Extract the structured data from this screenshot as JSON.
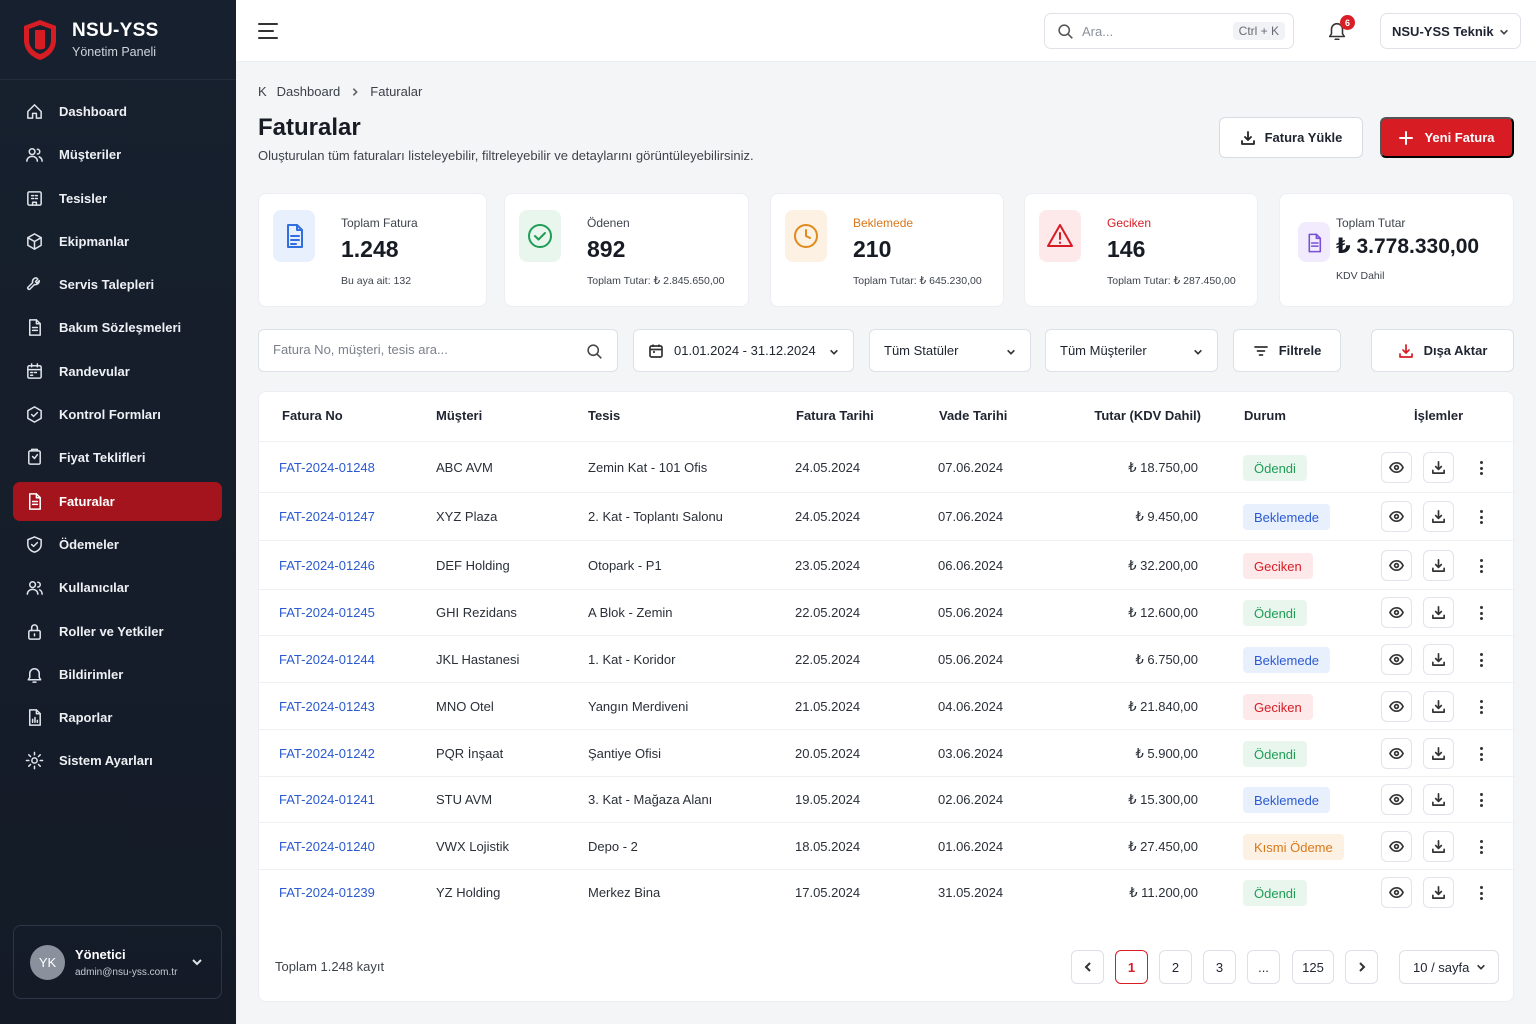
{
  "brand": {
    "title": "NSU-YSS",
    "subtitle": "Yönetim Paneli"
  },
  "sidebar": {
    "items": [
      {
        "label": "Dashboard",
        "icon": "home-icon"
      },
      {
        "label": "Müşteriler",
        "icon": "users-icon"
      },
      {
        "label": "Tesisler",
        "icon": "building-icon"
      },
      {
        "label": "Ekipmanlar",
        "icon": "box-icon"
      },
      {
        "label": "Servis Talepleri",
        "icon": "wrench-icon"
      },
      {
        "label": "Bakım Sözleşmeleri",
        "icon": "document-icon"
      },
      {
        "label": "Randevular",
        "icon": "calendar-icon"
      },
      {
        "label": "Kontrol Formları",
        "icon": "checklist-icon"
      },
      {
        "label": "Fiyat Teklifleri",
        "icon": "price-tag-icon"
      },
      {
        "label": "Faturalar",
        "icon": "invoice-icon",
        "active": true
      },
      {
        "label": "Ödemeler",
        "icon": "shield-check-icon"
      },
      {
        "label": "Kullanıcılar",
        "icon": "user-group-icon"
      },
      {
        "label": "Roller ve Yetkiler",
        "icon": "lock-icon"
      },
      {
        "label": "Bildirimler",
        "icon": "bell-icon"
      },
      {
        "label": "Raporlar",
        "icon": "report-icon"
      },
      {
        "label": "Sistem Ayarları",
        "icon": "gear-icon"
      }
    ],
    "user": {
      "initials": "YK",
      "name": "Yönetici",
      "email": "admin@nsu-yss.com.tr"
    }
  },
  "topbar": {
    "search_placeholder": "Ara...",
    "search_shortcut": "Ctrl + K",
    "notification_count": "6",
    "org_name": "NSU-YSS Teknik"
  },
  "breadcrumb": {
    "root": "K",
    "parent": "Dashboard",
    "current": "Faturalar"
  },
  "page": {
    "title": "Faturalar",
    "description": "Oluşturulan tüm faturaları listeleyebilir, filtreleyebilir ve detaylarını görüntüleyebilirsiniz.",
    "upload_label": "Fatura Yükle",
    "new_label": "Yeni Fatura"
  },
  "stats": [
    {
      "label": "Toplam Fatura",
      "value": "1.248",
      "sub": "Bu aya ait: 132",
      "color": "#2f6fe0",
      "bg": "#e9f0fd",
      "label_color": "#3e434c"
    },
    {
      "label": "Ödenen",
      "value": "892",
      "sub": "Toplam Tutar: ₺ 2.845.650,00",
      "color": "#1f9d55",
      "bg": "#e8f6ee",
      "label_color": "#3e434c"
    },
    {
      "label": "Beklemede",
      "value": "210",
      "sub": "Toplam Tutar: ₺ 645.230,00",
      "color": "#e08a1c",
      "bg": "#fdf1e3",
      "label_color": "#d9781a"
    },
    {
      "label": "Geciken",
      "value": "146",
      "sub": "Toplam Tutar: ₺ 287.450,00",
      "color": "#d71c24",
      "bg": "#fde9ea",
      "label_color": "#d71c24"
    },
    {
      "label": "Toplam Tutar",
      "value": "₺ 3.778.330,00",
      "sub": "KDV Dahil",
      "color": "#7a4fd6",
      "bg": "#f1ebfd",
      "label_color": "#3e434c"
    }
  ],
  "filters": {
    "search_placeholder": "Fatura No, müşteri, tesis ara...",
    "date_range": "01.01.2024 - 31.12.2024",
    "status": "Tüm Statüler",
    "customer": "Tüm Müşteriler",
    "filter_label": "Filtrele",
    "export_label": "Dışa Aktar"
  },
  "table": {
    "headers": [
      "Fatura No",
      "Müşteri",
      "Tesis",
      "Fatura Tarihi",
      "Vade Tarihi",
      "Tutar (KDV Dahil)",
      "Durum",
      "İşlemler"
    ],
    "rows": [
      {
        "no": "FAT-2024-01248",
        "customer": "ABC AVM",
        "facility": "Zemin Kat - 101 Ofis",
        "date": "24.05.2024",
        "due": "07.06.2024",
        "amount": "₺ 18.750,00",
        "status": "Ödendi"
      },
      {
        "no": "FAT-2024-01247",
        "customer": "XYZ Plaza",
        "facility": "2. Kat - Toplantı Salonu",
        "date": "24.05.2024",
        "due": "07.06.2024",
        "amount": "₺ 9.450,00",
        "status": "Beklemede"
      },
      {
        "no": "FAT-2024-01246",
        "customer": "DEF Holding",
        "facility": "Otopark - P1",
        "date": "23.05.2024",
        "due": "06.06.2024",
        "amount": "₺ 32.200,00",
        "status": "Geciken"
      },
      {
        "no": "FAT-2024-01245",
        "customer": "GHI Rezidans",
        "facility": "A Blok - Zemin",
        "date": "22.05.2024",
        "due": "05.06.2024",
        "amount": "₺ 12.600,00",
        "status": "Ödendi"
      },
      {
        "no": "FAT-2024-01244",
        "customer": "JKL Hastanesi",
        "facility": "1. Kat - Koridor",
        "date": "22.05.2024",
        "due": "05.06.2024",
        "amount": "₺ 6.750,00",
        "status": "Beklemede"
      },
      {
        "no": "FAT-2024-01243",
        "customer": "MNO Otel",
        "facility": "Yangın Merdiveni",
        "date": "21.05.2024",
        "due": "04.06.2024",
        "amount": "₺ 21.840,00",
        "status": "Geciken"
      },
      {
        "no": "FAT-2024-01242",
        "customer": "PQR İnşaat",
        "facility": "Şantiye Ofisi",
        "date": "20.05.2024",
        "due": "03.06.2024",
        "amount": "₺ 5.900,00",
        "status": "Ödendi"
      },
      {
        "no": "FAT-2024-01241",
        "customer": "STU AVM",
        "facility": "3. Kat - Mağaza Alanı",
        "date": "19.05.2024",
        "due": "02.06.2024",
        "amount": "₺ 15.300,00",
        "status": "Beklemede"
      },
      {
        "no": "FAT-2024-01240",
        "customer": "VWX Lojistik",
        "facility": "Depo - 2",
        "date": "18.05.2024",
        "due": "01.06.2024",
        "amount": "₺ 27.450,00",
        "status": "Kısmi Ödeme"
      },
      {
        "no": "FAT-2024-01239",
        "customer": "YZ Holding",
        "facility": "Merkez Bina",
        "date": "17.05.2024",
        "due": "31.05.2024",
        "amount": "₺ 11.200,00",
        "status": "Ödendi"
      }
    ],
    "status_styles": {
      "Ödendi": {
        "color": "#1f9d55",
        "bg": "#e8f6ee"
      },
      "Beklemede": {
        "color": "#2a5ad1",
        "bg": "#e9f0fd"
      },
      "Geciken": {
        "color": "#d71c24",
        "bg": "#fde9ea"
      },
      "Kısmi Ödeme": {
        "color": "#d9781a",
        "bg": "#fdf1e3"
      }
    }
  },
  "pagination": {
    "total_text": "Toplam 1.248 kayıt",
    "pages": [
      "1",
      "2",
      "3",
      "...",
      "125"
    ],
    "current": "1",
    "page_size": "10 / sayfa"
  }
}
